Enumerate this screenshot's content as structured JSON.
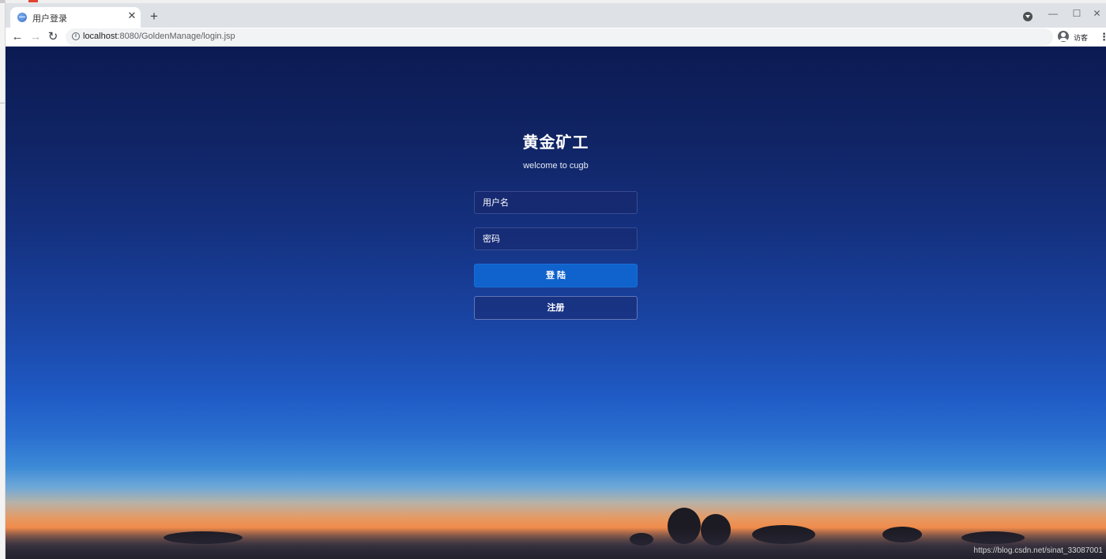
{
  "browser": {
    "tab": {
      "title": "用户登录",
      "close_label": "✕"
    },
    "new_tab_label": "+",
    "window_controls": {
      "minimize": "—",
      "maximize": "☐",
      "close": "✕"
    },
    "toolbar": {
      "back_label": "←",
      "forward_label": "→",
      "reload_label": "↻",
      "url_host": "localhost",
      "url_path": ":8080/GoldenManage/login.jsp",
      "profile_label": "访客",
      "menu_label": "⋮"
    }
  },
  "login": {
    "title": "黄金矿工",
    "subtitle": "welcome to cugb",
    "username_placeholder": "用户名",
    "password_placeholder": "密码",
    "login_button": "登 陆",
    "register_button": "注册"
  },
  "watermark": "https://blog.csdn.net/sinat_33087001",
  "colors": {
    "primary_button": "#1063cc",
    "sky_top": "#0c1a52",
    "sunset_orange": "#f08a4a"
  },
  "icons": {
    "tab_favicon": "globe-icon",
    "page_info": "info-icon",
    "profile": "avatar-icon",
    "tab_search": "tab-search-icon"
  }
}
